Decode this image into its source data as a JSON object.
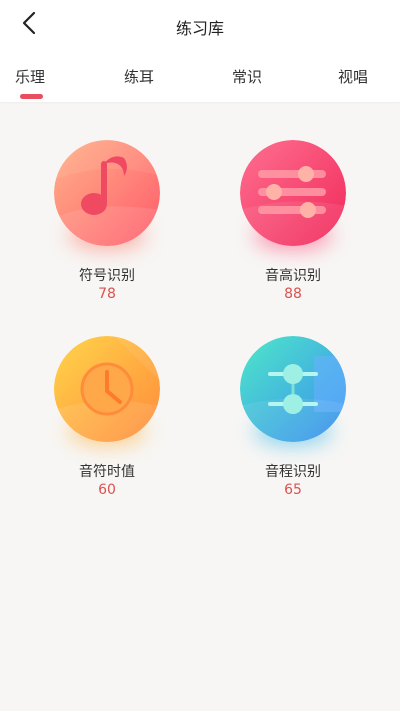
{
  "header": {
    "title": "练习库",
    "back_icon": "chevron-left-icon"
  },
  "tabs": [
    {
      "label": "乐理",
      "active": true
    },
    {
      "label": "练耳",
      "active": false
    },
    {
      "label": "常识",
      "active": false
    },
    {
      "label": "视唱",
      "active": false
    }
  ],
  "colors": {
    "accent": "#e94e5e",
    "count_text": "#d9534f"
  },
  "categories": [
    {
      "label": "符号识别",
      "count": "78",
      "icon": "music-note-icon"
    },
    {
      "label": "音高识别",
      "count": "88",
      "icon": "sliders-icon"
    },
    {
      "label": "音符时值",
      "count": "60",
      "icon": "clock-icon"
    },
    {
      "label": "音程识别",
      "count": "65",
      "icon": "interval-icon"
    }
  ]
}
